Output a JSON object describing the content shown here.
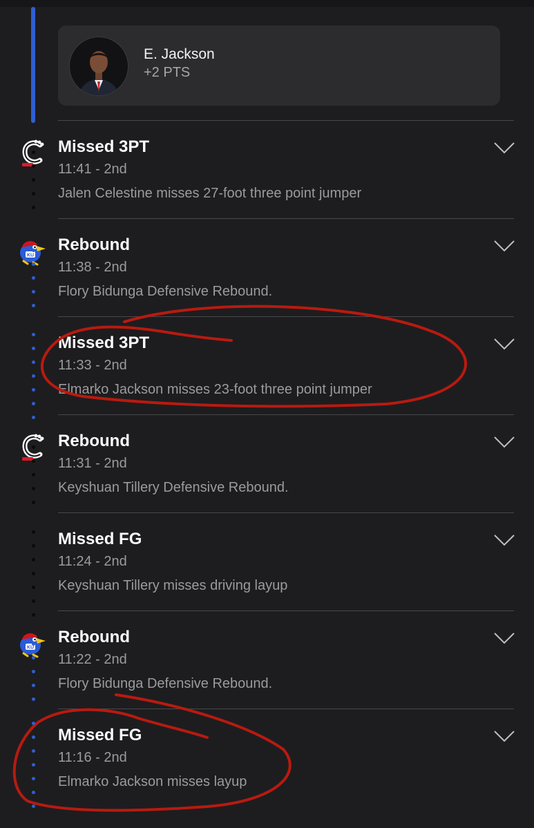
{
  "scorer": {
    "name": "E. Jackson",
    "points": "+2 PTS"
  },
  "colors": {
    "background": "#1d1d1f",
    "card": "#2c2c2e",
    "kansas_blue": "#2f5fd1",
    "cincinnati_red": "#e0162b",
    "annotation_red": "#b81a10"
  },
  "plays": [
    {
      "team": "cincinnati",
      "logo": "cincinnati-logo-icon",
      "title": "Missed 3PT",
      "time": "11:41 - 2nd",
      "desc": "Jalen Celestine misses 27-foot three point jumper"
    },
    {
      "team": "kansas",
      "logo": "kansas-jayhawk-logo-icon",
      "title": "Rebound",
      "time": "11:38 - 2nd",
      "desc": "Flory Bidunga Defensive Rebound."
    },
    {
      "team": "kansas",
      "logo": "",
      "title": "Missed 3PT",
      "time": "11:33 - 2nd",
      "desc": "Elmarko Jackson misses 23-foot three point jumper"
    },
    {
      "team": "cincinnati",
      "logo": "cincinnati-logo-icon",
      "title": "Rebound",
      "time": "11:31 - 2nd",
      "desc": "Keyshuan Tillery Defensive Rebound."
    },
    {
      "team": "cincinnati",
      "logo": "",
      "title": "Missed FG",
      "time": "11:24 - 2nd",
      "desc": "Keyshuan Tillery misses driving layup"
    },
    {
      "team": "kansas",
      "logo": "kansas-jayhawk-logo-icon",
      "title": "Rebound",
      "time": "11:22 - 2nd",
      "desc": "Flory Bidunga Defensive Rebound."
    },
    {
      "team": "kansas",
      "logo": "",
      "title": "Missed FG",
      "time": "11:16 - 2nd",
      "desc": "Elmarko Jackson misses layup"
    }
  ]
}
